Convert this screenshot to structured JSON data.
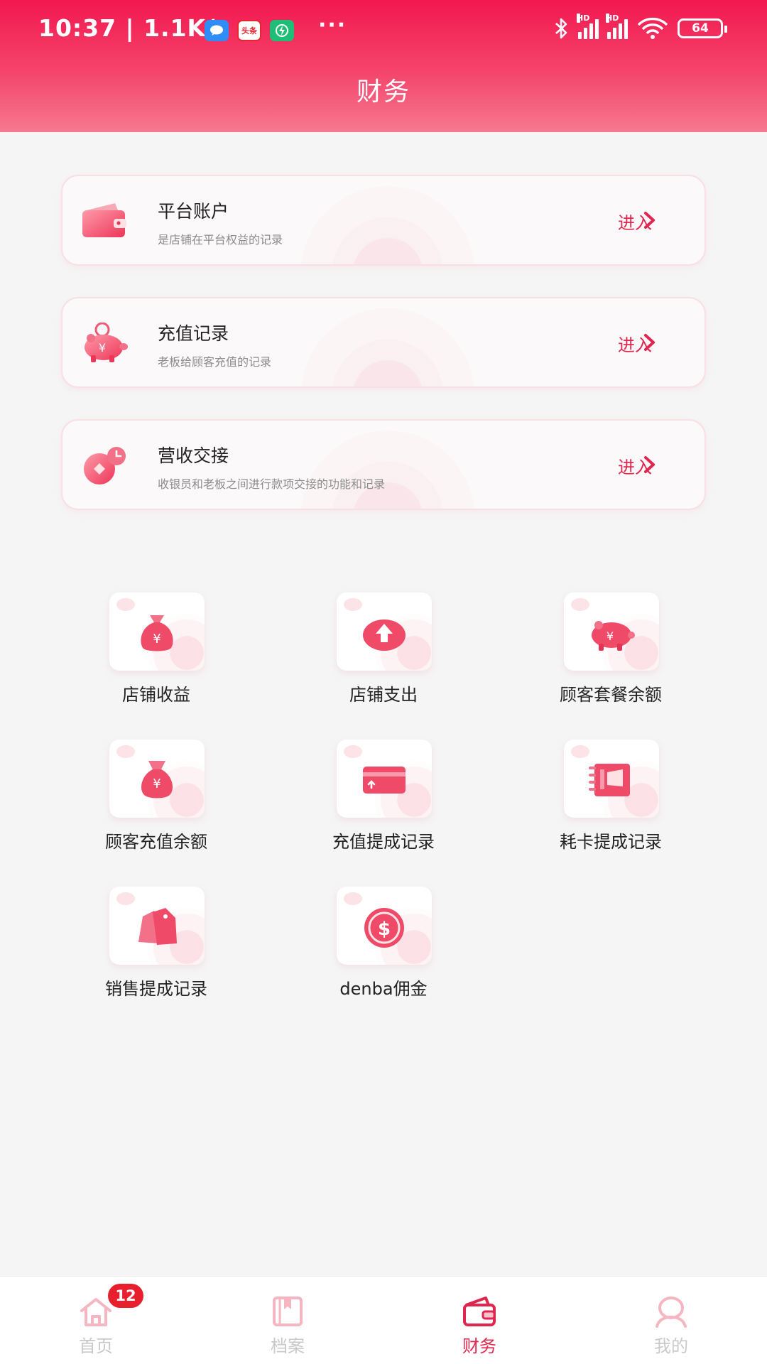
{
  "status_bar": {
    "time_speed": "10:37 | 1.1K/s",
    "news_app": "头条",
    "dots": "···",
    "signal_label": "HD",
    "battery": "64"
  },
  "header": {
    "title": "财务"
  },
  "cards": [
    {
      "title": "平台账户",
      "desc": "是店铺在平台权益的记录",
      "action": "进入",
      "icon": "wallet-icon"
    },
    {
      "title": "充值记录",
      "desc": "老板给顾客充值的记录",
      "action": "进入",
      "icon": "piggy-bank-icon"
    },
    {
      "title": "营收交接",
      "desc": "收银员和老板之间进行款项交接的功能和记录",
      "action": "进入",
      "icon": "coin-clock-icon"
    }
  ],
  "grid": [
    {
      "label": "店铺收益",
      "icon": "money-bag-icon"
    },
    {
      "label": "店铺支出",
      "icon": "upload-circle-icon"
    },
    {
      "label": "顾客套餐余额",
      "icon": "piggy-bank-icon"
    },
    {
      "label": "顾客充值余额",
      "icon": "money-bag-icon"
    },
    {
      "label": "充值提成记录",
      "icon": "card-icon"
    },
    {
      "label": "耗卡提成记录",
      "icon": "notebook-icon"
    },
    {
      "label": "销售提成记录",
      "icon": "price-tag-icon"
    },
    {
      "label": "denba佣金",
      "icon": "dollar-coin-icon"
    }
  ],
  "bottom_nav": [
    {
      "label": "首页",
      "icon": "home-icon",
      "badge": "12"
    },
    {
      "label": "档案",
      "icon": "folder-icon"
    },
    {
      "label": "财务",
      "icon": "wallet-icon",
      "active": true
    },
    {
      "label": "我的",
      "icon": "profile-icon"
    }
  ],
  "colors": {
    "accent": "#e0264f",
    "header_top": "#f2184f",
    "header_bottom": "#f67990",
    "badge": "#e8202e",
    "background": "#f5f5f6"
  }
}
